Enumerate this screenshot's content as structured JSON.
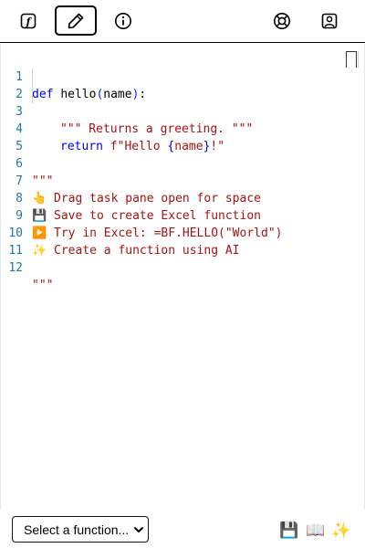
{
  "toolbar": {
    "tabs": [
      {
        "id": "functions",
        "icon": "function-icon",
        "active": false
      },
      {
        "id": "editor",
        "icon": "pencil-icon",
        "active": true
      },
      {
        "id": "info",
        "icon": "info-icon",
        "active": false
      },
      {
        "id": "help",
        "icon": "lifebuoy-icon",
        "active": false
      },
      {
        "id": "account",
        "icon": "user-portrait-icon",
        "active": false
      }
    ]
  },
  "editor": {
    "line_numbers": [
      "1",
      "2",
      "3",
      "4",
      "5",
      "6",
      "7",
      "8",
      "9",
      "10",
      "11",
      "12"
    ],
    "line1": {
      "def": "def",
      "name": "hello",
      "open": "(",
      "param": "name",
      "close": ")",
      "colon": ":"
    },
    "line2": {
      "docstring": "\"\"\" Returns a greeting. \"\"\""
    },
    "line3": {
      "return": "return",
      "prefix": "f\"Hello ",
      "open_brace": "{",
      "var": "name",
      "close_brace": "}",
      "suffix": "!\""
    },
    "line6": "\"\"\"",
    "line7": {
      "emoji": "👆",
      "text": "Drag task pane open for space"
    },
    "line8": {
      "emoji": "💾",
      "text": "Save to create Excel function"
    },
    "line9": {
      "emoji": "▶️",
      "text": "Try in Excel: =BF.HELLO(\"World\")"
    },
    "line10": {
      "emoji": "✨",
      "text": "Create a function using AI"
    },
    "line12": "\"\"\""
  },
  "bottom": {
    "select_placeholder": "Select a function...",
    "save_icon": "💾",
    "docs_icon": "📖",
    "ai_icon": "✨"
  },
  "colors": {
    "keyword": "#0000ff",
    "string": "#a31515",
    "line_number": "#237893"
  }
}
